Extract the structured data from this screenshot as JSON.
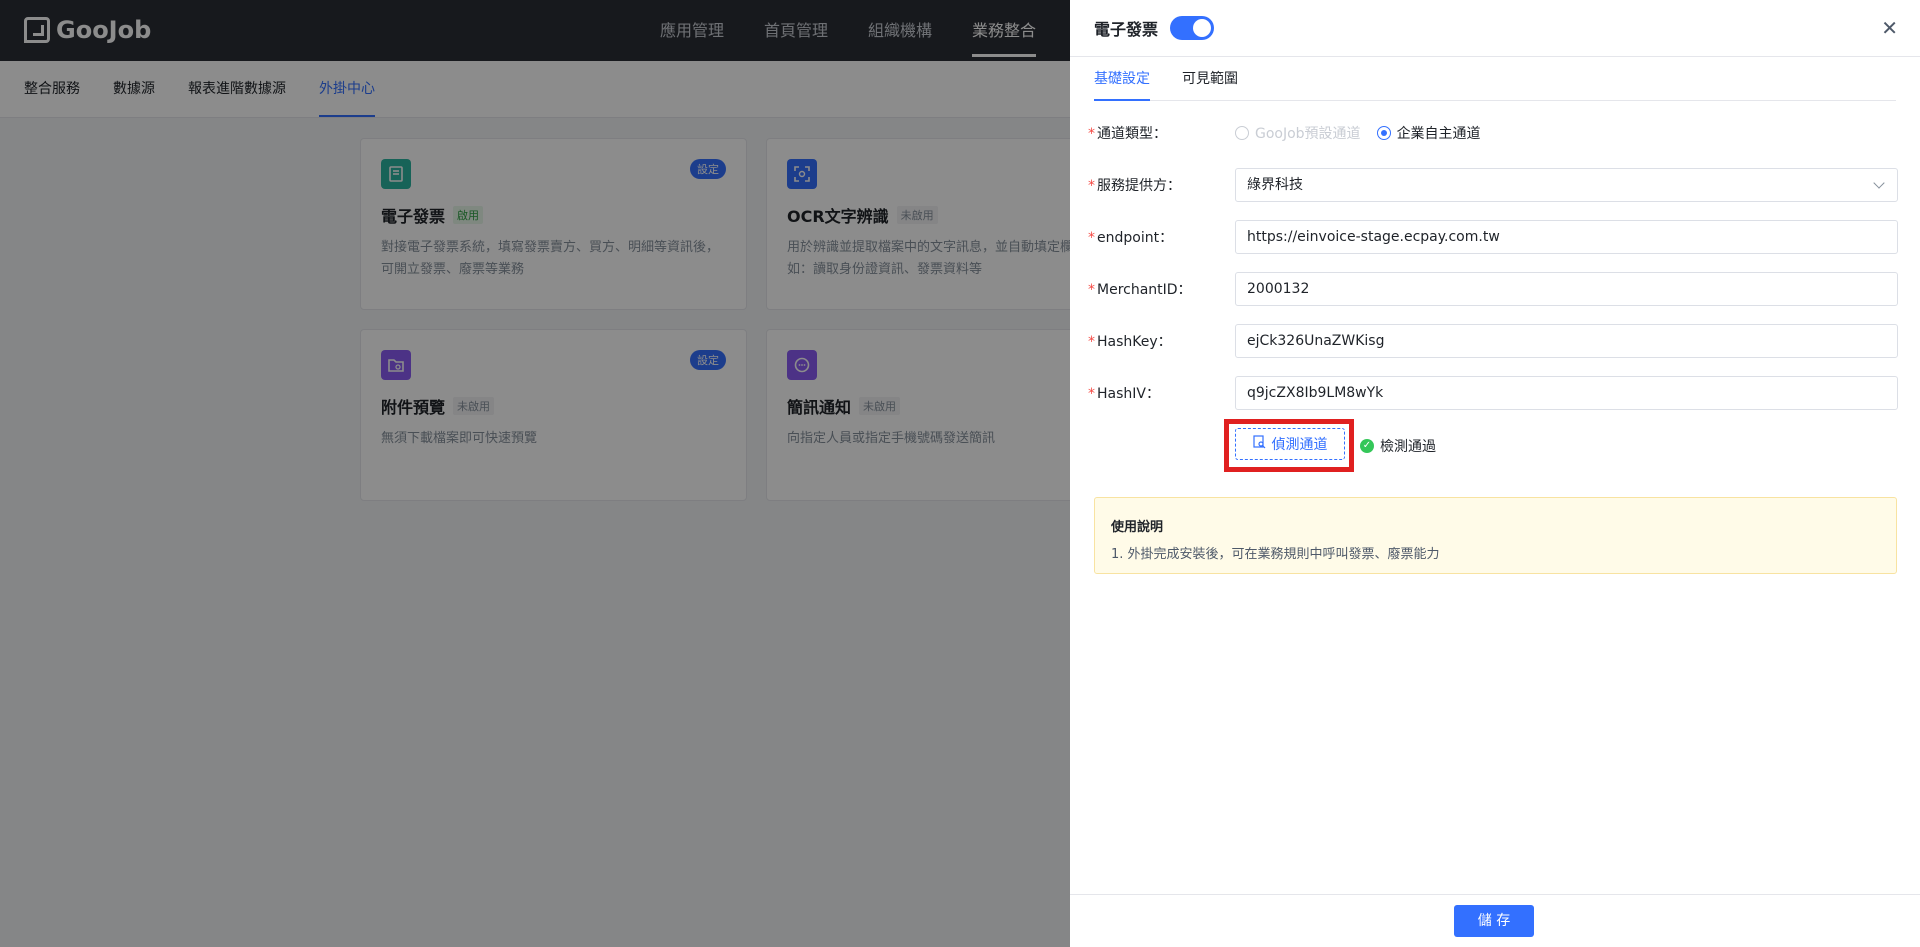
{
  "app": {
    "logo_text": "GooJob"
  },
  "topnav": {
    "items": [
      "應用管理",
      "首頁管理",
      "組織機構",
      "業務整合"
    ]
  },
  "subnav": {
    "items": [
      "整合服務",
      "數據源",
      "報表進階數據源",
      "外掛中心"
    ]
  },
  "cards": [
    {
      "title": "電子發票",
      "status": "啟用",
      "config_label": "設定",
      "icon": "invoice-icon",
      "desc": "對接電子發票系統，填寫發票賣方、買方、明細等資訊後，可開立發票、廢票等業務"
    },
    {
      "title": "OCR文字辨識",
      "status": "未啟用",
      "icon": "ocr-scan-icon",
      "desc": "用於辨識並提取檔案中的文字訊息，並自動填定欄位。例如：讀取身份證資訊、發票資料等"
    },
    {
      "title": "附件預覽",
      "status": "未啟用",
      "config_label": "設定",
      "icon": "folder-preview-icon",
      "desc": "無須下載檔案即可快速預覽"
    },
    {
      "title": "簡訊通知",
      "status": "未啟用",
      "icon": "message-icon",
      "desc": "向指定人員或指定手機號碼發送簡訊"
    }
  ],
  "drawer": {
    "title": "電子發票",
    "tabs": [
      "基礎設定",
      "可見範圍"
    ],
    "fields": {
      "channel_type": {
        "label": "通道類型：",
        "options": [
          "GooJob預設通道",
          "企業自主通道"
        ]
      },
      "provider": {
        "label": "服務提供方：",
        "value": "綠界科技"
      },
      "endpoint": {
        "label": "endpoint：",
        "value": "https://einvoice-stage.ecpay.com.tw"
      },
      "merchant_id": {
        "label": "MerchantID：",
        "value": "2000132"
      },
      "hash_key": {
        "label": "HashKey：",
        "value": "ejCk326UnaZWKisg"
      },
      "hash_iv": {
        "label": "HashIV：",
        "value": "q9jcZX8Ib9LM8wYk"
      }
    },
    "detect_label": "偵測通道",
    "detect_result": "檢測通過",
    "notice_title": "使用說明",
    "notice_body": "1. 外掛完成安裝後，可在業務規則中呼叫發票、廢票能力",
    "save_label": "儲 存"
  },
  "colors": {
    "accent": "#3370ff",
    "header_bg": "#2b2f36",
    "highlight": "#e02020"
  }
}
